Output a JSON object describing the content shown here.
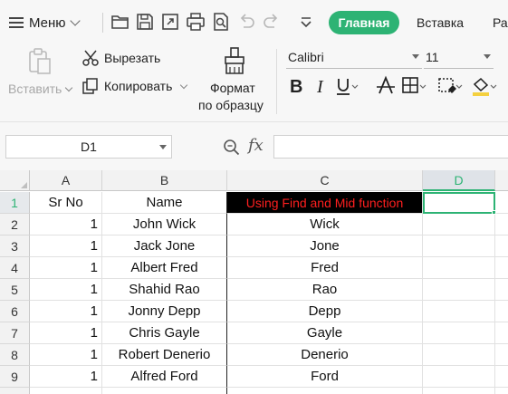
{
  "menubar": {
    "menu_label": "Меню",
    "tabs": [
      {
        "label": "Главная",
        "active": true
      },
      {
        "label": "Вставка",
        "active": false
      },
      {
        "label": "Ра",
        "active": false
      }
    ],
    "quick_icons": [
      "folder-open-icon",
      "save-icon",
      "export-icon",
      "print-icon",
      "print-preview-icon",
      "undo-icon",
      "redo-icon",
      "more-chevron-icon"
    ],
    "accent_color": "#2db374"
  },
  "ribbon": {
    "paste_label": "Вставить",
    "cut_label": "Вырезать",
    "copy_label": "Копировать",
    "format_painter_label_1": "Формат",
    "format_painter_label_2": "по образцу",
    "font_name": "Calibri",
    "font_size": "11",
    "format_icons": [
      "bold-icon",
      "italic-icon",
      "underline-icon",
      "strikethrough-icon",
      "borders-icon",
      "cell-styles-icon",
      "fill-color-icon"
    ]
  },
  "formula_bar": {
    "name_box": "D1",
    "fx_label": "fx",
    "formula_value": ""
  },
  "sheet": {
    "columns": [
      "A",
      "B",
      "C",
      "D"
    ],
    "active_column": "D",
    "active_row": "1",
    "rows": [
      {
        "num": "1",
        "a": "Sr No",
        "b": "Name",
        "c": "Using Find and Mid function",
        "d": ""
      },
      {
        "num": "2",
        "a": "1",
        "b": "John Wick",
        "c": "Wick",
        "d": ""
      },
      {
        "num": "3",
        "a": "1",
        "b": "Jack Jone",
        "c": "Jone",
        "d": ""
      },
      {
        "num": "4",
        "a": "1",
        "b": "Albert Fred",
        "c": "Fred",
        "d": ""
      },
      {
        "num": "5",
        "a": "1",
        "b": "Shahid Rao",
        "c": "Rao",
        "d": ""
      },
      {
        "num": "6",
        "a": "1",
        "b": "Jonny Depp",
        "c": "Depp",
        "d": ""
      },
      {
        "num": "7",
        "a": "1",
        "b": "Chris Gayle",
        "c": "Gayle",
        "d": ""
      },
      {
        "num": "8",
        "a": "1",
        "b": "Robert Denerio",
        "c": "Denerio",
        "d": ""
      },
      {
        "num": "9",
        "a": "1",
        "b": "Alfred Ford",
        "c": "Ford",
        "d": ""
      }
    ]
  }
}
